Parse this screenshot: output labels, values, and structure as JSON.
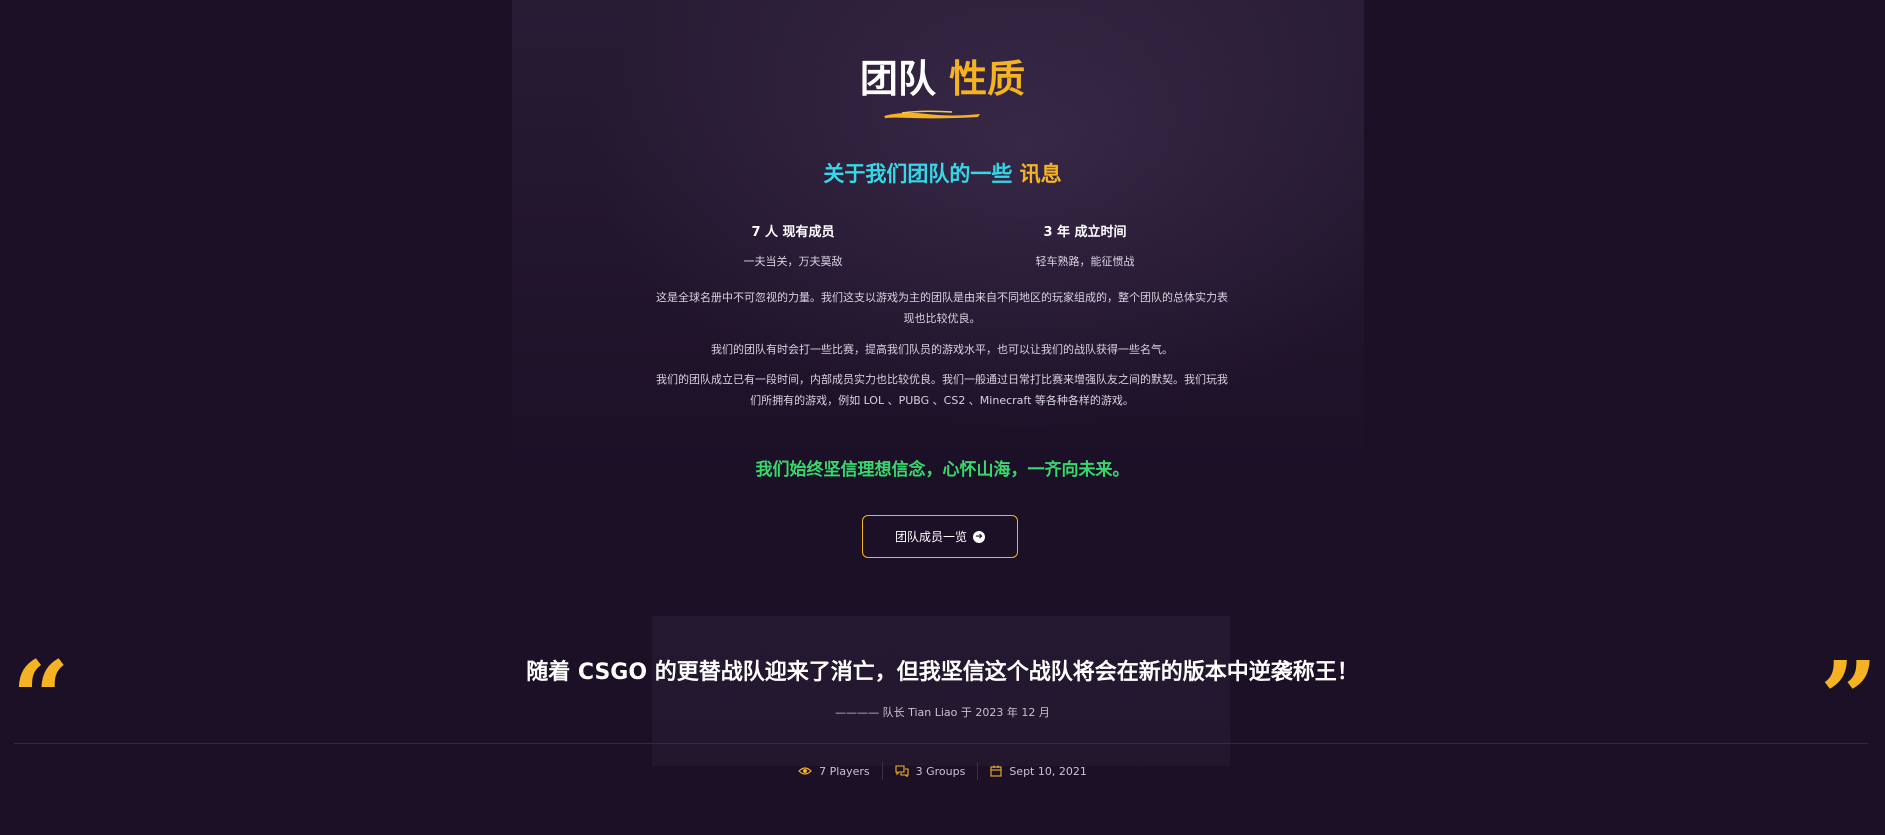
{
  "section": {
    "title_main": "团队",
    "title_highlight": "性质",
    "subtitle_main": "关于我们团队的一些",
    "subtitle_highlight": "讯息"
  },
  "stats": [
    {
      "head": "7 人 现有成员",
      "sub": "一夫当关，万夫莫敌"
    },
    {
      "head": "3 年 成立时间",
      "sub": "轻车熟路，能征惯战"
    }
  ],
  "paragraphs": [
    "这是全球名册中不可忽视的力量。我们这支以游戏为主的团队是由来自不同地区的玩家组成的，整个团队的总体实力表现也比较优良。",
    "我们的团队有时会打一些比赛，提高我们队员的游戏水平，也可以让我们的战队获得一些名气。",
    "我们的团队成立已有一段时间，内部成员实力也比较优良。我们一般通过日常打比赛来增强队友之间的默契。我们玩我们所拥有的游戏，例如 LOL 、PUBG 、CS2 、Minecraft 等各种各样的游戏。"
  ],
  "motto": "我们始终坚信理想信念，心怀山海，一齐向未来。",
  "button": {
    "label": "团队成员一览"
  },
  "quote": {
    "open_mark": "“",
    "close_mark": "”",
    "text": "随着 CSGO 的更替战队迎来了消亡，但我坚信这个战队将会在新的版本中逆袭称王！",
    "author": "———— 队长 Tian Liao 于 2023 年 12 月"
  },
  "meta": {
    "players": "7 Players",
    "groups": "3 Groups",
    "date": "Sept 10, 2021"
  },
  "colors": {
    "background": "#1c1027",
    "accent": "#f5b324",
    "subtitle": "#35d7e8",
    "motto": "#38d86b"
  },
  "icons": [
    "eye-icon",
    "chat-icon",
    "calendar-icon",
    "arrow-right-circle-icon"
  ]
}
